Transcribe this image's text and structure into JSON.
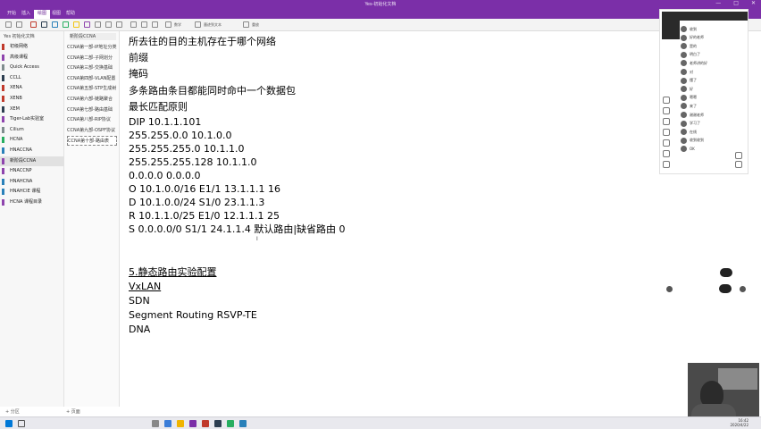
{
  "window": {
    "title": "Yes-初始化文档",
    "controls": [
      "—",
      "□",
      "✕"
    ]
  },
  "ribbon": {
    "tabs": [
      "开始",
      "插入",
      "绘图",
      "视图",
      "帮助"
    ],
    "active_tab": "绘图",
    "toolbar_labels": [
      "复制",
      "粘贴",
      "笔",
      "橡皮擦",
      "套索",
      "墨迹到文本",
      "数学",
      "重放"
    ]
  },
  "notebooks": {
    "header": "Yes 初始化文档",
    "items": [
      {
        "label": "初级网络",
        "color": "#c0392b"
      },
      {
        "label": "高级课程",
        "color": "#8e44ad"
      },
      {
        "label": "Quick Access",
        "color": "#7f8c8d"
      },
      {
        "label": "CCLL",
        "color": "#2c3e50"
      },
      {
        "label": "XENA",
        "color": "#c0392b"
      },
      {
        "label": "XENB",
        "color": "#c0392b"
      },
      {
        "label": "XEM",
        "color": "#2c3e50"
      },
      {
        "label": "Tiger-Lab实验室",
        "color": "#8e44ad"
      },
      {
        "label": "Cilium",
        "color": "#7f8c8d"
      },
      {
        "label": "HCNA",
        "color": "#27ae60"
      },
      {
        "label": "HNACCNA",
        "color": "#2980b9"
      },
      {
        "label": "新阶段CCNA",
        "color": "#8e44ad",
        "selected": true
      },
      {
        "label": "HNACCNP",
        "color": "#8e44ad"
      },
      {
        "label": "HNAHCNA",
        "color": "#2980b9"
      },
      {
        "label": "HNAHCIE 课程",
        "color": "#2980b9"
      },
      {
        "label": "HCNA 课程目录",
        "color": "#8e44ad"
      }
    ],
    "footer": "+ 分区"
  },
  "sections": {
    "header": "新阶段CCNA",
    "items": [
      {
        "label": "CCNA第一部-IP地址分类"
      },
      {
        "label": "CCNA第二部-子网划分"
      },
      {
        "label": "CCNA第三部-交换基础"
      },
      {
        "label": "CCNA第四部-VLAN配置"
      },
      {
        "label": "CCNA第五部-STP生成树"
      },
      {
        "label": "CCNA第六部-链路聚合"
      },
      {
        "label": "CCNA第七部-路由基础"
      },
      {
        "label": "CCNA第八部-RIP协议"
      },
      {
        "label": "CCNA第九部-OSPF协议"
      },
      {
        "label": "CCNA第十部-路由表",
        "selected": true
      }
    ],
    "footer": "+ 页面"
  },
  "content": {
    "lines": [
      {
        "text": "所去往的目的主机存在于哪个网络"
      },
      {
        "text": "前缀"
      },
      {
        "text": "掩码"
      },
      {
        "text": "多条路由条目都能同时命中一个数据包"
      },
      {
        "text": "最长匹配原则"
      },
      {
        "text": "DIP 10.1.1.101"
      },
      {
        "text": "255.255.0.0  10.1.0.0"
      },
      {
        "text": "255.255.255.0 10.1.1.0"
      },
      {
        "text": "255.255.255.128 10.1.1.0"
      },
      {
        "text": "0.0.0.0 0.0.0.0"
      },
      {
        "text": "O  10.1.0.0/16  E1/1 13.1.1.1    16"
      },
      {
        "text": "D  10.1.0.0/24  S1/0  23.1.1.3"
      },
      {
        "text": "R  10.1.1.0/25  E1/0  12.1.1.1    25"
      },
      {
        "text": "S  0.0.0.0/0   S1/1  24.1.1.4    默认路由|缺省路由  0"
      },
      {
        "text": "5.静态路由实验配置",
        "underline": true
      },
      {
        "text": "VxLAN",
        "underline": true
      },
      {
        "text": "SDN"
      },
      {
        "text": "Segment Routing RSVP-TE"
      },
      {
        "text": "DNA"
      }
    ]
  },
  "side_panel": {
    "messages": [
      "收到",
      "好的老师",
      "是的",
      "明白了",
      "老师讲的好",
      "对",
      "懂了",
      "好",
      "嗯嗯",
      "来了",
      "谢谢老师",
      "学习了",
      "在线",
      "收到收到",
      "OK"
    ]
  },
  "taskbar": {
    "time": "16:42",
    "date": "2020/4/22"
  },
  "colors": {
    "accent": "#7b2fa8",
    "text": "#000000",
    "panel_bg": "#f7f7f7"
  }
}
